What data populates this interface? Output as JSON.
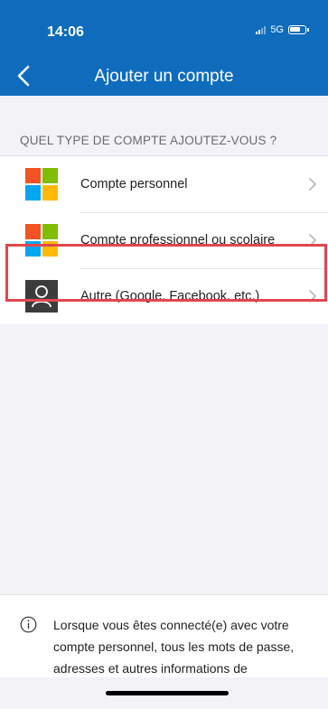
{
  "status_bar": {
    "time": "14:06",
    "network": "5G"
  },
  "nav": {
    "title": "Ajouter un compte",
    "back_icon": "chevron-left-icon"
  },
  "section": {
    "label": "QUEL TYPE DE COMPTE AJOUTEZ-VOUS ?"
  },
  "accounts": [
    {
      "label": "Compte personnel",
      "icon": "microsoft-logo-icon"
    },
    {
      "label": "Compte professionnel ou scolaire",
      "icon": "microsoft-logo-icon"
    },
    {
      "label": "Autre (Google, Facebook, etc.)",
      "icon": "person-icon",
      "highlighted": true
    }
  ],
  "info": {
    "icon": "info-icon",
    "text": "Lorsque vous êtes connecté(e) avec votre compte personnel, tous les mots de passe, adresses et autres informations de"
  },
  "colors": {
    "header": "#0f6cbd",
    "highlight_border": "#e0474c",
    "ms_red": "#f35325",
    "ms_green": "#81bc06",
    "ms_blue": "#05a6f0",
    "ms_yellow": "#ffba08"
  }
}
